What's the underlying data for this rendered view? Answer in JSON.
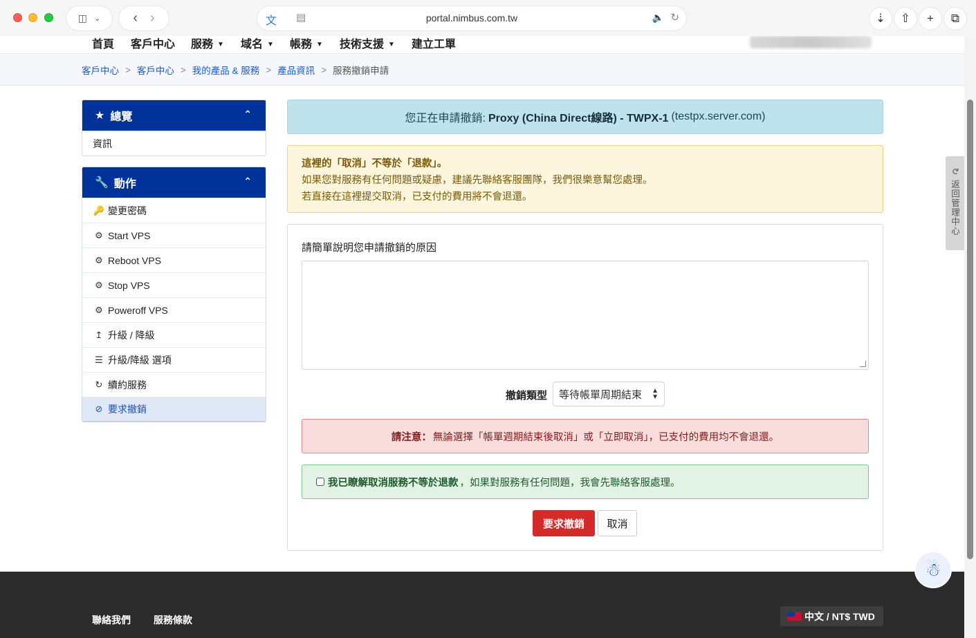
{
  "browser": {
    "url": "portal.nimbus.com.tw",
    "icons": [
      "sidebar-icon",
      "chevron-down-icon",
      "back-icon",
      "forward-icon",
      "translate-icon",
      "reader-icon",
      "speaker-icon",
      "reload-icon",
      "download-icon",
      "share-icon",
      "new-tab-icon",
      "tabs-icon"
    ]
  },
  "topnav": {
    "items": [
      {
        "label": "首頁",
        "dropdown": false
      },
      {
        "label": "客戶中心",
        "dropdown": false
      },
      {
        "label": "服務",
        "dropdown": true
      },
      {
        "label": "域名",
        "dropdown": true
      },
      {
        "label": "帳務",
        "dropdown": true
      },
      {
        "label": "技術支援",
        "dropdown": true
      },
      {
        "label": "建立工單",
        "dropdown": false
      }
    ]
  },
  "breadcrumb": {
    "items": [
      "客戶中心",
      "客戶中心",
      "我的產品 & 服務",
      "產品資訊"
    ],
    "separator": ">",
    "current": "服務撤銷申請"
  },
  "overview_panel": {
    "title": "總覽",
    "icon": "star-icon",
    "rows": [
      {
        "label": "資訊"
      }
    ]
  },
  "actions_panel": {
    "title": "動作",
    "icon": "wrench-icon",
    "rows": [
      {
        "label": "變更密碼",
        "icon": "key-icon"
      },
      {
        "label": "Start VPS",
        "icon": "gears-icon"
      },
      {
        "label": "Reboot VPS",
        "icon": "gears-icon"
      },
      {
        "label": "Stop VPS",
        "icon": "gears-icon"
      },
      {
        "label": "Poweroff VPS",
        "icon": "gears-icon"
      },
      {
        "label": "升級 / 降級",
        "icon": "arrow-up-icon"
      },
      {
        "label": "升級/降級 選項",
        "icon": "list-icon"
      },
      {
        "label": "續約服務",
        "icon": "refresh-icon"
      },
      {
        "label": "要求撤銷",
        "icon": "ban-icon",
        "active": true
      }
    ]
  },
  "notice": {
    "prefix": "您正在申請撤銷:",
    "product": "Proxy (China Direct線路) - TWPX-1",
    "domain": "(testpx.server.com)"
  },
  "warning": {
    "title": "這裡的「取消」不等於「退款」。",
    "line1": "如果您對服務有任何問題或疑慮，建議先聯絡客服團隊，我們很樂意幫您處理。",
    "line2": "若直接在這裡提交取消，已支付的費用將不會退還。"
  },
  "form": {
    "reason_label": "請簡單說明您申請撤銷的原因",
    "reason_value": "",
    "type_label": "撤銷類型",
    "type_selected": "等待帳單周期結束",
    "danger_bold": "請注意：",
    "danger_text": "無論選擇「帳單週期結束後取消」或「立即取消」，已支付的費用均不會退還。",
    "confirm_bold": "我已瞭解取消服務不等於退款",
    "confirm_text": "，如果對服務有任何問題，我會先聯絡客服處理。",
    "submit_label": "要求撤銷",
    "cancel_label": "取消"
  },
  "side_tab": {
    "label": "返回管理中心"
  },
  "footer": {
    "links": [
      "聯絡我們",
      "服務條款"
    ],
    "language": "中文 / NT$ TWD"
  },
  "colors": {
    "primary": "#003399",
    "danger": "#d42a2a",
    "link": "#1a5cc8",
    "footer": "#2b2b2b"
  }
}
